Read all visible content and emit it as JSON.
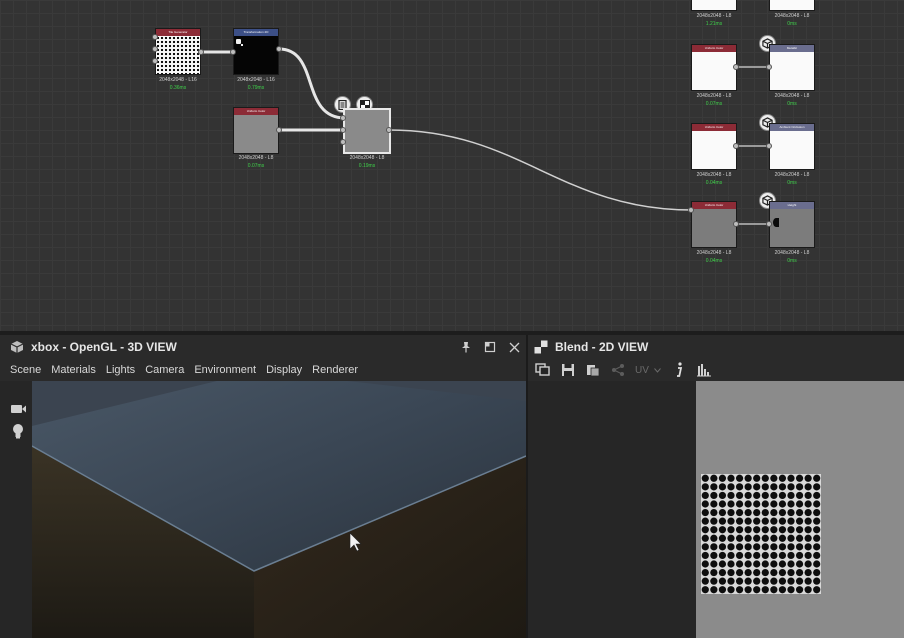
{
  "graph": {
    "nodes": [
      {
        "title": "Tile Generator",
        "size": "2048x2048 - L16",
        "time": "0.36ms"
      },
      {
        "title": "Transformation 2D",
        "size": "2048x2048 - L16",
        "time": "0.79ms"
      },
      {
        "title": "Uniform Color",
        "size": "2048x2048 - L8",
        "time": "0.07ms"
      },
      {
        "title": "",
        "size": "2048x2048 - L8",
        "time": "0.19ms"
      },
      {
        "title": "",
        "size": "2048x2048 - L8",
        "time": "1.21ms"
      },
      {
        "title": "",
        "size": "2048x2048 - L8",
        "time": "0ms"
      },
      {
        "title": "Uniform Color",
        "size": "2048x2048 - L8",
        "time": "0.07ms"
      },
      {
        "title": "Metallic",
        "size": "2048x2048 - L8",
        "time": "0ms"
      },
      {
        "title": "Uniform Color",
        "size": "2048x2048 - L8",
        "time": "0.04ms"
      },
      {
        "title": "Ambient Occlusion",
        "size": "2048x2048 - L8",
        "time": "0ms"
      },
      {
        "title": "Uniform Color",
        "size": "2048x2048 - L8",
        "time": "0.04ms"
      },
      {
        "title": "Height",
        "size": "2048x2048 - L8",
        "time": "0ms"
      }
    ]
  },
  "view3d": {
    "title": "xbox - OpenGL - 3D VIEW",
    "menu": [
      "Scene",
      "Materials",
      "Lights",
      "Camera",
      "Environment",
      "Display",
      "Renderer"
    ]
  },
  "view2d": {
    "title": "Blend - 2D VIEW",
    "uv_label": "UV"
  },
  "colors": {
    "accent_red": "#8c2b36",
    "accent_blue": "#3c4f86",
    "timing_green": "#3fcf4a"
  }
}
